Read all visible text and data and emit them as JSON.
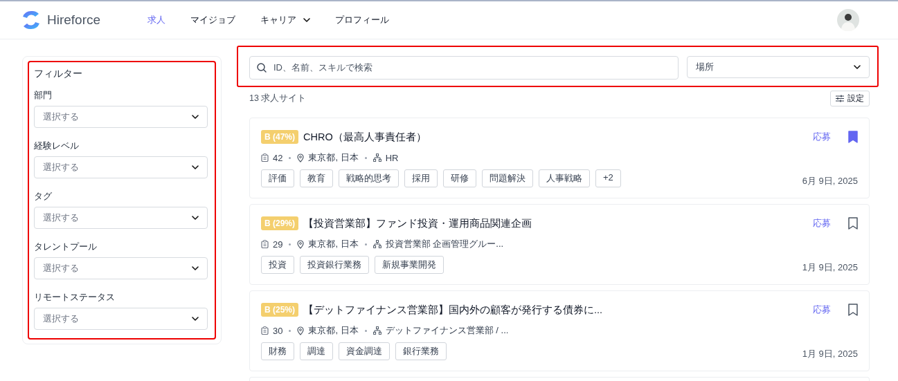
{
  "brand": "Hireforce",
  "nav": [
    {
      "label": "求人",
      "selected": true,
      "has_menu": false
    },
    {
      "label": "マイジョブ",
      "selected": false,
      "has_menu": false
    },
    {
      "label": "キャリア",
      "selected": false,
      "has_menu": true
    },
    {
      "label": "プロフィール",
      "selected": false,
      "has_menu": false
    }
  ],
  "filters": {
    "title": "フィルター",
    "fields": [
      {
        "label": "部門",
        "placeholder": "選択する"
      },
      {
        "label": "経験レベル",
        "placeholder": "選択する"
      },
      {
        "label": "タグ",
        "placeholder": "選択する"
      },
      {
        "label": "タレントプール",
        "placeholder": "選択する"
      },
      {
        "label": "リモートステータス",
        "placeholder": "選択する"
      }
    ]
  },
  "search": {
    "placeholder": "ID、名前、スキルで検索"
  },
  "location": {
    "placeholder": "場所"
  },
  "results_count": "13 求人サイト",
  "settings_button": "設定",
  "jobs": [
    {
      "grade": "B (47%)",
      "title": "CHRO（最高人事責任者）",
      "openings": "42",
      "location": "東京都, 日本",
      "department": "HR",
      "tags": [
        "評価",
        "教育",
        "戦略的思考",
        "採用",
        "研修",
        "問題解決",
        "人事戦略",
        "+2"
      ],
      "date": "6月 9日, 2025",
      "apply": "応募",
      "bookmarked": true
    },
    {
      "grade": "B (29%)",
      "title": "【投資営業部】ファンド投資・運用商品関連企画",
      "openings": "29",
      "location": "東京都, 日本",
      "department": "投資営業部 企画管理グルー...",
      "tags": [
        "投資",
        "投資銀行業務",
        "新規事業開発"
      ],
      "date": "1月 9日, 2025",
      "apply": "応募",
      "bookmarked": false
    },
    {
      "grade": "B (25%)",
      "title": "【デットファイナンス営業部】国内外の顧客が発行する債券に...",
      "openings": "30",
      "location": "東京都, 日本",
      "department": "デットファイナンス営業部 / ...",
      "tags": [
        "財務",
        "調達",
        "資金調達",
        "銀行業務"
      ],
      "date": "1月 9日, 2025",
      "apply": "応募",
      "bookmarked": false
    }
  ]
}
